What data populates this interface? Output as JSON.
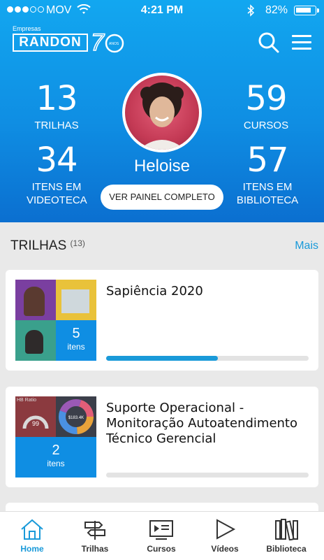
{
  "status": {
    "carrier": "MOV",
    "time": "4:21 PM",
    "battery": "82%",
    "battery_level": 0.82
  },
  "brand": {
    "small": "Empresas",
    "name": "RANDON",
    "anniversary": "70",
    "anos": "ANOS"
  },
  "profile": {
    "name": "Heloise",
    "button": "VER PAINEL COMPLETO",
    "stats": [
      {
        "value": "13",
        "label": "TRILHAS"
      },
      {
        "value": "59",
        "label": "CURSOS"
      },
      {
        "value": "34",
        "label": "ITENS EM VIDEOTECA"
      },
      {
        "value": "57",
        "label": "ITENS EM BIBLIOTECA"
      }
    ]
  },
  "section": {
    "title": "TRILHAS",
    "count": "(13)",
    "more": "Mais"
  },
  "cards": [
    {
      "title": "Sapiência 2020",
      "count": "5",
      "unit": "itens",
      "progress": 0.55
    },
    {
      "title": "Suporte Operacional - Monitoração Autoatendimento Técnico Gerencial",
      "count": "2",
      "unit": "itens",
      "progress": 0
    }
  ],
  "thumb2": {
    "label": "HB Ratio",
    "gauge": "99",
    "amount": "$183.4K"
  },
  "tabs": [
    {
      "label": "Home",
      "icon": "home-icon",
      "active": true
    },
    {
      "label": "Trilhas",
      "icon": "signpost-icon",
      "active": false
    },
    {
      "label": "Cursos",
      "icon": "course-screen-icon",
      "active": false
    },
    {
      "label": "Vídeos",
      "icon": "play-icon",
      "active": false
    },
    {
      "label": "Biblioteca",
      "icon": "books-icon",
      "active": false
    }
  ],
  "colors": {
    "accent": "#1a9ad9",
    "header_top": "#12a7f0",
    "header_bottom": "#0b6fd0"
  }
}
